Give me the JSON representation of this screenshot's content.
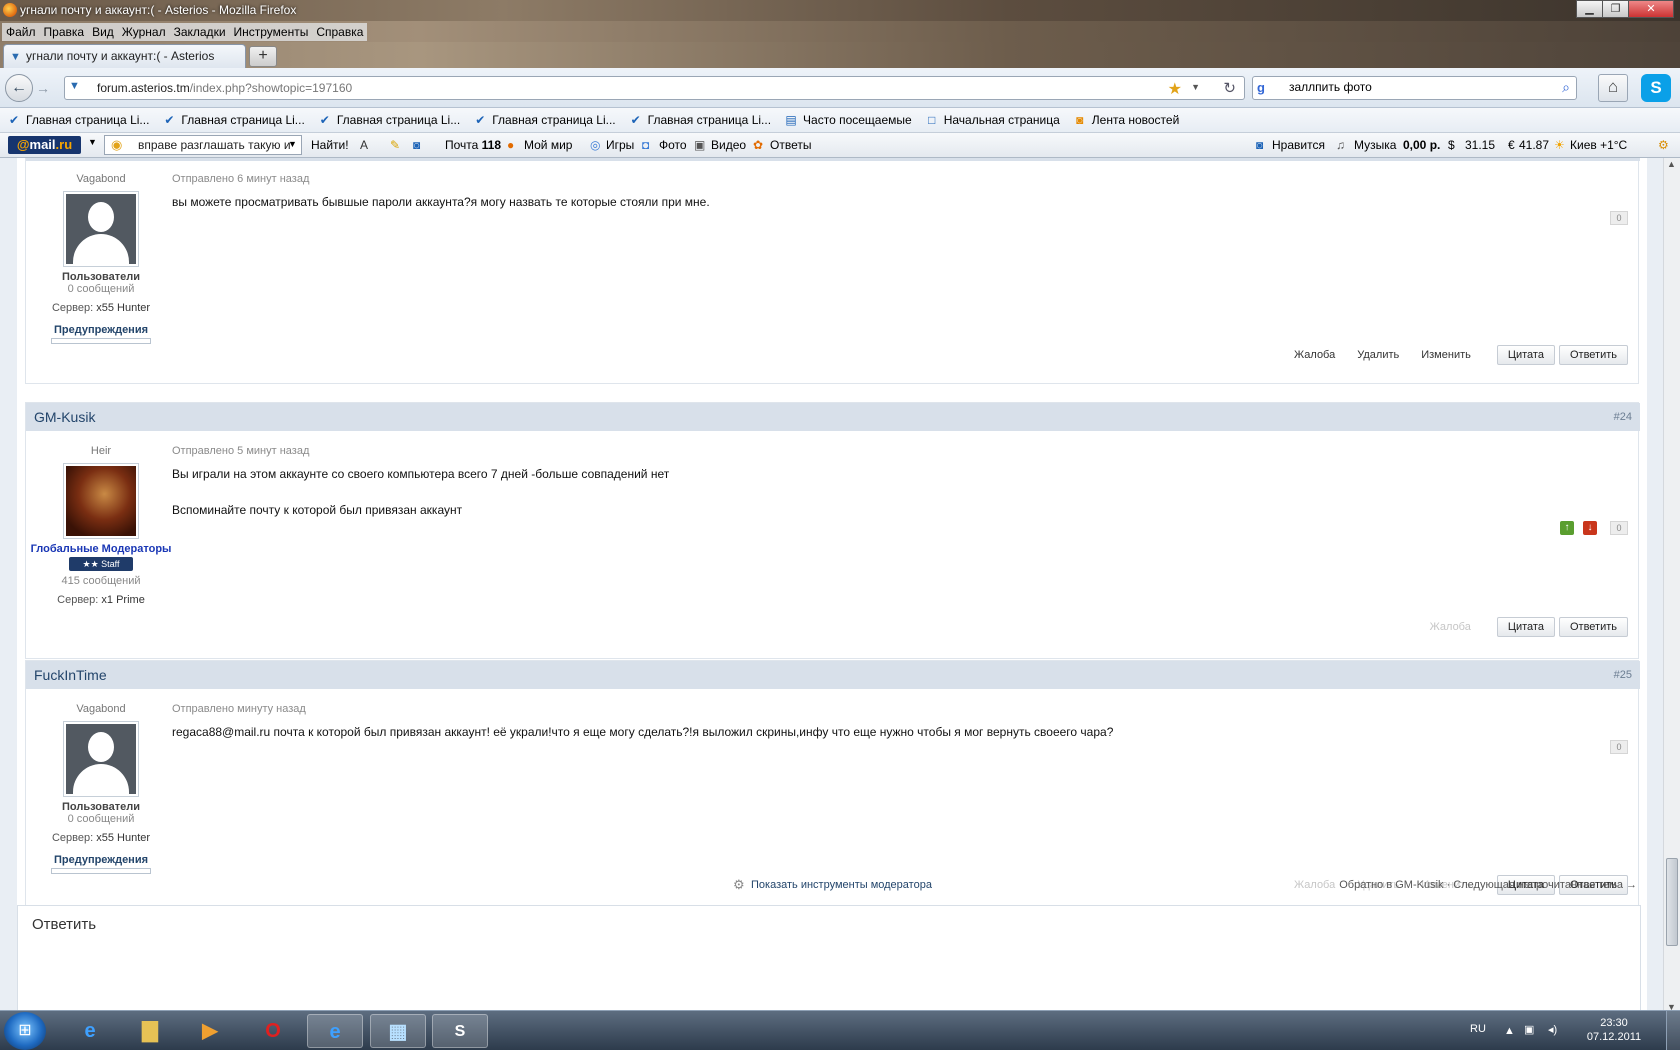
{
  "window": {
    "title": "угнали почту и аккаунт:( - Asterios - Mozilla Firefox",
    "min": "▁",
    "max": "❐",
    "close": "✕"
  },
  "menu": [
    "Файл",
    "Правка",
    "Вид",
    "Журнал",
    "Закладки",
    "Инструменты",
    "Справка"
  ],
  "tab": {
    "title": "угнали почту и аккаунт:( - Asterios",
    "new": "+"
  },
  "nav": {
    "url_host": "forum.asterios.tm",
    "url_path": "/index.php?showtopic=197160",
    "search_value": "заллпить фото"
  },
  "bookmarks": [
    "Главная страница Li...",
    "Главная страница Li...",
    "Главная страница Li...",
    "Главная страница Li...",
    "Главная страница Li...",
    "Часто посещаемые",
    "Начальная страница",
    "Лента новостей"
  ],
  "mailru": {
    "logo_at": "@",
    "logo_text": "mail",
    "logo_ru": ".ru",
    "search_text": "вправе разглашать такую и",
    "find": "Найти!",
    "pochta": "Почта",
    "pochta_count": "118",
    "moy_mir": "Мой мир",
    "igry": "Игры",
    "foto": "Фото",
    "video": "Видео",
    "otvety": "Ответы",
    "nravitsya": "Нравится",
    "muzyka": "Музыка",
    "balance": "0,00 р.",
    "usd": "31.15",
    "eur": "41.87",
    "weather": "Киев +1°C"
  },
  "posts": [
    {
      "title": "Vagabond",
      "date": "Отправлено 6 минут назад",
      "text": [
        "вы можете просматривать бывшые пароли аккаунта?я могу назвать те которые стояли при мне."
      ],
      "group": "Пользователи",
      "count": "0 сообщений",
      "server_label": "Сервер:",
      "server": "x55 Hunter",
      "warnings": "Предупреждения",
      "rep": "0",
      "actions": [
        "Жалоба",
        "Удалить",
        "Изменить"
      ],
      "buttons": [
        "Цитата",
        "Ответить"
      ]
    },
    {
      "author": "GM-Kusik",
      "num": "#24",
      "title": "Heir",
      "date": "Отправлено 5 минут назад",
      "text": [
        "Вы играли на этом аккаунте со своего компьютера всего 7 дней -больше совпадений нет",
        "Вспоминайте почту к которой был привязан аккаунт"
      ],
      "group": "Глобальные Модераторы",
      "staff": "★★ Staff",
      "count": "415 сообщений",
      "server_label": "Сервер:",
      "server": "x1 Prime",
      "rep": "0",
      "actions": [
        "Жалоба"
      ],
      "buttons": [
        "Цитата",
        "Ответить"
      ]
    },
    {
      "author": "FuckInTime",
      "num": "#25",
      "title": "Vagabond",
      "date": "Отправлено минуту назад",
      "text": [
        "regaca88@mail.ru почта к которой был привязан аккаунт! её украли!что я еще могу сделать?!я выложил скрины,инфу что еще нужно чтобы я мог вернуть своеего чара?"
      ],
      "group": "Пользователи",
      "count": "0 сообщений",
      "server_label": "Сервер:",
      "server": "x55 Hunter",
      "warnings": "Предупреждения",
      "rep": "0",
      "actions": [
        "Жалоба",
        "Удалить",
        "Изменить"
      ],
      "buttons": [
        "Цитата",
        "Ответить"
      ]
    }
  ],
  "footer": {
    "mod_tools": "Показать инструменты модератора",
    "nav": "Обратно в GM-Kusik · Следующая непрочитанная тема →",
    "reply_title": "Ответить"
  },
  "taskbar": {
    "lang": "RU",
    "time": "23:30",
    "date": "07.12.2011"
  },
  "colors": {
    "accent": "#23456b",
    "post_header": "#d8e0ea"
  }
}
